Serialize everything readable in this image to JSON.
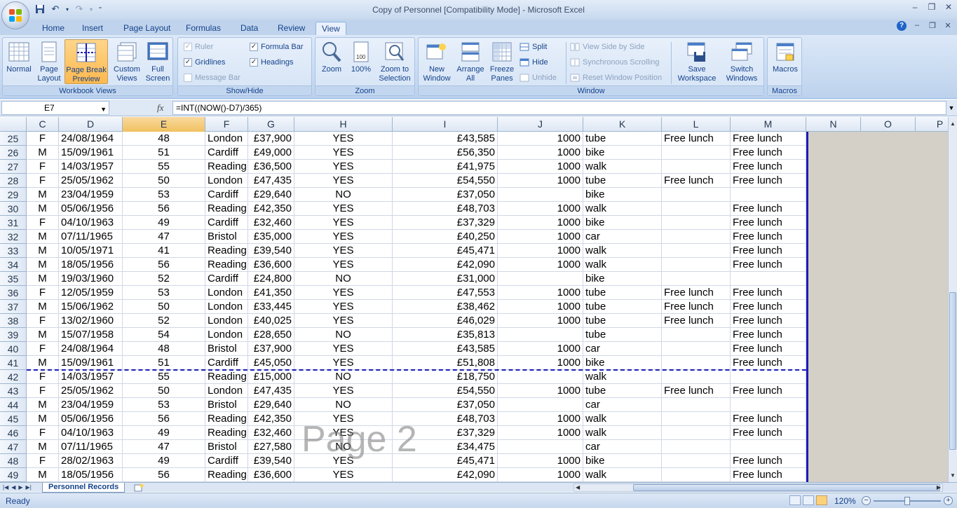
{
  "window": {
    "title": "Copy of Personnel  [Compatibility Mode] - Microsoft Excel",
    "minimize": "–",
    "restore": "❐",
    "close": "✕"
  },
  "tabs": [
    {
      "label": "Home"
    },
    {
      "label": "Insert"
    },
    {
      "label": "Page Layout"
    },
    {
      "label": "Formulas"
    },
    {
      "label": "Data"
    },
    {
      "label": "Review"
    },
    {
      "label": "View"
    }
  ],
  "active_tab": "View",
  "ribbon": {
    "workbook_views": {
      "label": "Workbook Views",
      "normal": "Normal",
      "page_layout": "Page Layout",
      "page_break_preview": "Page Break Preview",
      "custom_views": "Custom Views",
      "full_screen": "Full Screen"
    },
    "show_hide": {
      "label": "Show/Hide",
      "ruler": "Ruler",
      "gridlines": "Gridlines",
      "message_bar": "Message Bar",
      "formula_bar": "Formula Bar",
      "headings": "Headings"
    },
    "zoom": {
      "label": "Zoom",
      "zoom": "Zoom",
      "hundred": "100%",
      "zoom_to_selection": "Zoom to Selection"
    },
    "window": {
      "label": "Window",
      "new_window": "New Window",
      "arrange_all": "Arrange All",
      "freeze_panes": "Freeze Panes",
      "split": "Split",
      "hide": "Hide",
      "unhide": "Unhide",
      "view_side_by_side": "View Side by Side",
      "synchronous_scrolling": "Synchronous Scrolling",
      "reset_window_position": "Reset Window Position",
      "save_workspace": "Save Workspace",
      "switch_windows": "Switch Windows"
    },
    "macros": {
      "label": "Macros",
      "macros": "Macros"
    }
  },
  "formula_bar": {
    "name_box": "E7",
    "fx": "fx",
    "formula": "=INT((NOW()-D7)/365)"
  },
  "columns": [
    "C",
    "D",
    "E",
    "F",
    "G",
    "H",
    "I",
    "J",
    "K",
    "L",
    "M",
    "N",
    "O",
    "P"
  ],
  "selected_column": "E",
  "rows": [
    {
      "n": "25",
      "C": "F",
      "D": "24/08/1964",
      "E": "48",
      "F": "London",
      "G": "£37,900",
      "H": "YES",
      "I": "£43,585",
      "J": "1000",
      "K": "tube",
      "L": "Free lunch",
      "M": "Free lunch"
    },
    {
      "n": "26",
      "C": "M",
      "D": "15/09/1961",
      "E": "51",
      "F": "Cardiff",
      "G": "£49,000",
      "H": "YES",
      "I": "£56,350",
      "J": "1000",
      "K": "bike",
      "L": "",
      "M": "Free lunch"
    },
    {
      "n": "27",
      "C": "F",
      "D": "14/03/1957",
      "E": "55",
      "F": "Reading",
      "G": "£36,500",
      "H": "YES",
      "I": "£41,975",
      "J": "1000",
      "K": "walk",
      "L": "",
      "M": "Free lunch"
    },
    {
      "n": "28",
      "C": "F",
      "D": "25/05/1962",
      "E": "50",
      "F": "London",
      "G": "£47,435",
      "H": "YES",
      "I": "£54,550",
      "J": "1000",
      "K": "tube",
      "L": "Free lunch",
      "M": "Free lunch"
    },
    {
      "n": "29",
      "C": "M",
      "D": "23/04/1959",
      "E": "53",
      "F": "Cardiff",
      "G": "£29,640",
      "H": "NO",
      "I": "£37,050",
      "J": "",
      "K": "bike",
      "L": "",
      "M": ""
    },
    {
      "n": "30",
      "C": "M",
      "D": "05/06/1956",
      "E": "56",
      "F": "Reading",
      "G": "£42,350",
      "H": "YES",
      "I": "£48,703",
      "J": "1000",
      "K": "walk",
      "L": "",
      "M": "Free lunch"
    },
    {
      "n": "31",
      "C": "F",
      "D": "04/10/1963",
      "E": "49",
      "F": "Cardiff",
      "G": "£32,460",
      "H": "YES",
      "I": "£37,329",
      "J": "1000",
      "K": "bike",
      "L": "",
      "M": "Free lunch"
    },
    {
      "n": "32",
      "C": "M",
      "D": "07/11/1965",
      "E": "47",
      "F": "Bristol",
      "G": "£35,000",
      "H": "YES",
      "I": "£40,250",
      "J": "1000",
      "K": "car",
      "L": "",
      "M": "Free lunch"
    },
    {
      "n": "33",
      "C": "M",
      "D": "10/05/1971",
      "E": "41",
      "F": "Reading",
      "G": "£39,540",
      "H": "YES",
      "I": "£45,471",
      "J": "1000",
      "K": "walk",
      "L": "",
      "M": "Free lunch"
    },
    {
      "n": "34",
      "C": "M",
      "D": "18/05/1956",
      "E": "56",
      "F": "Reading",
      "G": "£36,600",
      "H": "YES",
      "I": "£42,090",
      "J": "1000",
      "K": "walk",
      "L": "",
      "M": "Free lunch"
    },
    {
      "n": "35",
      "C": "M",
      "D": "19/03/1960",
      "E": "52",
      "F": "Cardiff",
      "G": "£24,800",
      "H": "NO",
      "I": "£31,000",
      "J": "",
      "K": "bike",
      "L": "",
      "M": ""
    },
    {
      "n": "36",
      "C": "F",
      "D": "12/05/1959",
      "E": "53",
      "F": "London",
      "G": "£41,350",
      "H": "YES",
      "I": "£47,553",
      "J": "1000",
      "K": "tube",
      "L": "Free lunch",
      "M": "Free lunch"
    },
    {
      "n": "37",
      "C": "M",
      "D": "15/06/1962",
      "E": "50",
      "F": "London",
      "G": "£33,445",
      "H": "YES",
      "I": "£38,462",
      "J": "1000",
      "K": "tube",
      "L": "Free lunch",
      "M": "Free lunch"
    },
    {
      "n": "38",
      "C": "F",
      "D": "13/02/1960",
      "E": "52",
      "F": "London",
      "G": "£40,025",
      "H": "YES",
      "I": "£46,029",
      "J": "1000",
      "K": "tube",
      "L": "Free lunch",
      "M": "Free lunch"
    },
    {
      "n": "39",
      "C": "M",
      "D": "15/07/1958",
      "E": "54",
      "F": "London",
      "G": "£28,650",
      "H": "NO",
      "I": "£35,813",
      "J": "",
      "K": "tube",
      "L": "",
      "M": "Free lunch"
    },
    {
      "n": "40",
      "C": "F",
      "D": "24/08/1964",
      "E": "48",
      "F": "Bristol",
      "G": "£37,900",
      "H": "YES",
      "I": "£43,585",
      "J": "1000",
      "K": "car",
      "L": "",
      "M": "Free lunch"
    },
    {
      "n": "41",
      "C": "M",
      "D": "15/09/1961",
      "E": "51",
      "F": "Cardiff",
      "G": "£45,050",
      "H": "YES",
      "I": "£51,808",
      "J": "1000",
      "K": "bike",
      "L": "",
      "M": "Free lunch"
    },
    {
      "n": "42",
      "C": "F",
      "D": "14/03/1957",
      "E": "55",
      "F": "Reading",
      "G": "£15,000",
      "H": "NO",
      "I": "£18,750",
      "J": "",
      "K": "walk",
      "L": "",
      "M": ""
    },
    {
      "n": "43",
      "C": "F",
      "D": "25/05/1962",
      "E": "50",
      "F": "London",
      "G": "£47,435",
      "H": "YES",
      "I": "£54,550",
      "J": "1000",
      "K": "tube",
      "L": "Free lunch",
      "M": "Free lunch"
    },
    {
      "n": "44",
      "C": "M",
      "D": "23/04/1959",
      "E": "53",
      "F": "Bristol",
      "G": "£29,640",
      "H": "NO",
      "I": "£37,050",
      "J": "",
      "K": "car",
      "L": "",
      "M": ""
    },
    {
      "n": "45",
      "C": "M",
      "D": "05/06/1956",
      "E": "56",
      "F": "Reading",
      "G": "£42,350",
      "H": "YES",
      "I": "£48,703",
      "J": "1000",
      "K": "walk",
      "L": "",
      "M": "Free lunch"
    },
    {
      "n": "46",
      "C": "F",
      "D": "04/10/1963",
      "E": "49",
      "F": "Reading",
      "G": "£32,460",
      "H": "YES",
      "I": "£37,329",
      "J": "1000",
      "K": "walk",
      "L": "",
      "M": "Free lunch"
    },
    {
      "n": "47",
      "C": "M",
      "D": "07/11/1965",
      "E": "47",
      "F": "Bristol",
      "G": "£27,580",
      "H": "NO",
      "I": "£34,475",
      "J": "",
      "K": "car",
      "L": "",
      "M": ""
    },
    {
      "n": "48",
      "C": "F",
      "D": "28/02/1963",
      "E": "49",
      "F": "Cardiff",
      "G": "£39,540",
      "H": "YES",
      "I": "£45,471",
      "J": "1000",
      "K": "bike",
      "L": "",
      "M": "Free lunch"
    },
    {
      "n": "49",
      "C": "M",
      "D": "18/05/1956",
      "E": "56",
      "F": "Reading",
      "G": "£36,600",
      "H": "YES",
      "I": "£42,090",
      "J": "1000",
      "K": "walk",
      "L": "",
      "M": "Free lunch"
    }
  ],
  "page_watermark": "Page 2",
  "sheet_tab": "Personnel Records",
  "status": {
    "text": "Ready",
    "zoom": "120%",
    "zoom_fraction": 0.5
  },
  "colors": {
    "page_break": "#1c1cb8",
    "selected_header": "#f1c15f",
    "ribbon_active": "#fdb94e"
  }
}
